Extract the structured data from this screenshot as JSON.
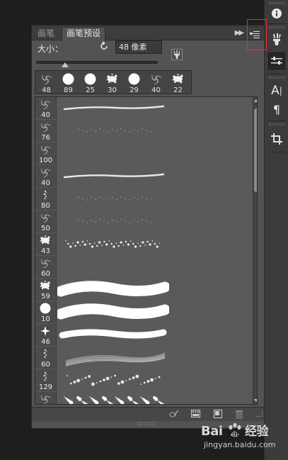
{
  "tabs": [
    {
      "label": "画笔"
    },
    {
      "label": "画笔预设"
    }
  ],
  "panel": {
    "size_label": "大小：",
    "size_value": "48 像素",
    "size_slider_fraction": 0.24
  },
  "recent_brushes": [
    {
      "size": "48",
      "shape": "speckle"
    },
    {
      "size": "89",
      "shape": "round"
    },
    {
      "size": "25",
      "shape": "round"
    },
    {
      "size": "30",
      "shape": "splatter"
    },
    {
      "size": "29",
      "shape": "round"
    },
    {
      "size": "40",
      "shape": "speckle"
    },
    {
      "size": "22",
      "shape": "splatter"
    }
  ],
  "presets": [
    {
      "size": "40",
      "shape": "speckle",
      "stroke": "thin-line"
    },
    {
      "size": "76",
      "shape": "speckle",
      "stroke": "faint-dots"
    },
    {
      "size": "100",
      "shape": "speckle",
      "stroke": "none"
    },
    {
      "size": "40",
      "shape": "speckle",
      "stroke": "thin-line"
    },
    {
      "size": "80",
      "shape": "dots",
      "stroke": "faint-dots"
    },
    {
      "size": "50",
      "shape": "speckle",
      "stroke": "faint-dots"
    },
    {
      "size": "43",
      "shape": "splatter",
      "stroke": "scatter"
    },
    {
      "size": "60",
      "shape": "speckle",
      "stroke": "none"
    },
    {
      "size": "59",
      "shape": "splatter",
      "stroke": "thick-rough"
    },
    {
      "size": "10",
      "shape": "round",
      "stroke": "thick-rough"
    },
    {
      "size": "46",
      "shape": "star",
      "stroke": "medium-rough"
    },
    {
      "size": "60",
      "shape": "dots",
      "stroke": "bristle"
    },
    {
      "size": "129",
      "shape": "dots",
      "stroke": "scatter-light"
    },
    {
      "size": "",
      "shape": "speckle",
      "stroke": "scatter-heavy"
    }
  ],
  "icons": {
    "info": "info-icon",
    "brush": "brush-icon",
    "brush_presets": "brush-presets-icon",
    "character": "character-icon",
    "paragraph": "paragraph-icon",
    "crop": "crop-icon"
  },
  "highlight_color": "#e33333",
  "watermark": {
    "logo": "Bai度经验",
    "url": "jingyan.baidu.com"
  }
}
